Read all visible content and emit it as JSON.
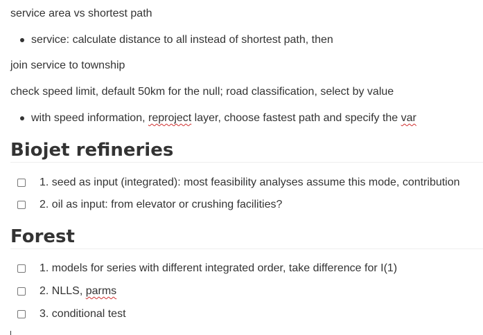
{
  "paragraphs": {
    "p1": "service area vs shortest path",
    "p2": "join service to township",
    "p3": "check speed limit, default 50km for the null; road classification, select by value"
  },
  "bullets": {
    "b1": "service: calculate distance to all instead of shortest path, then",
    "b2": {
      "part1": "with speed information, ",
      "spell1": "reproject",
      "part2": " layer, choose fastest path and specify the ",
      "spell2": "var"
    }
  },
  "sections": {
    "biojet": {
      "heading": "Biojet refineries",
      "tasks": [
        {
          "text": "1. seed as input (integrated): most feasibility analyses assume this mode, contribution",
          "checked": false
        },
        {
          "text": "2. oil as input: from elevator or crushing facilities?",
          "checked": false
        }
      ]
    },
    "forest": {
      "heading": "Forest",
      "tasks": [
        {
          "text": "1. models for series with different integrated order, take difference for I(1)",
          "checked": false
        },
        {
          "prefix": "2. NLLS, ",
          "spell": "parms",
          "checked": false
        },
        {
          "text": "3. conditional test",
          "checked": false
        }
      ]
    }
  },
  "colors": {
    "text": "#333333",
    "spellcheck_underline": "#d03030",
    "rule": "#eeeeee",
    "checkbox_border": "#777777"
  }
}
